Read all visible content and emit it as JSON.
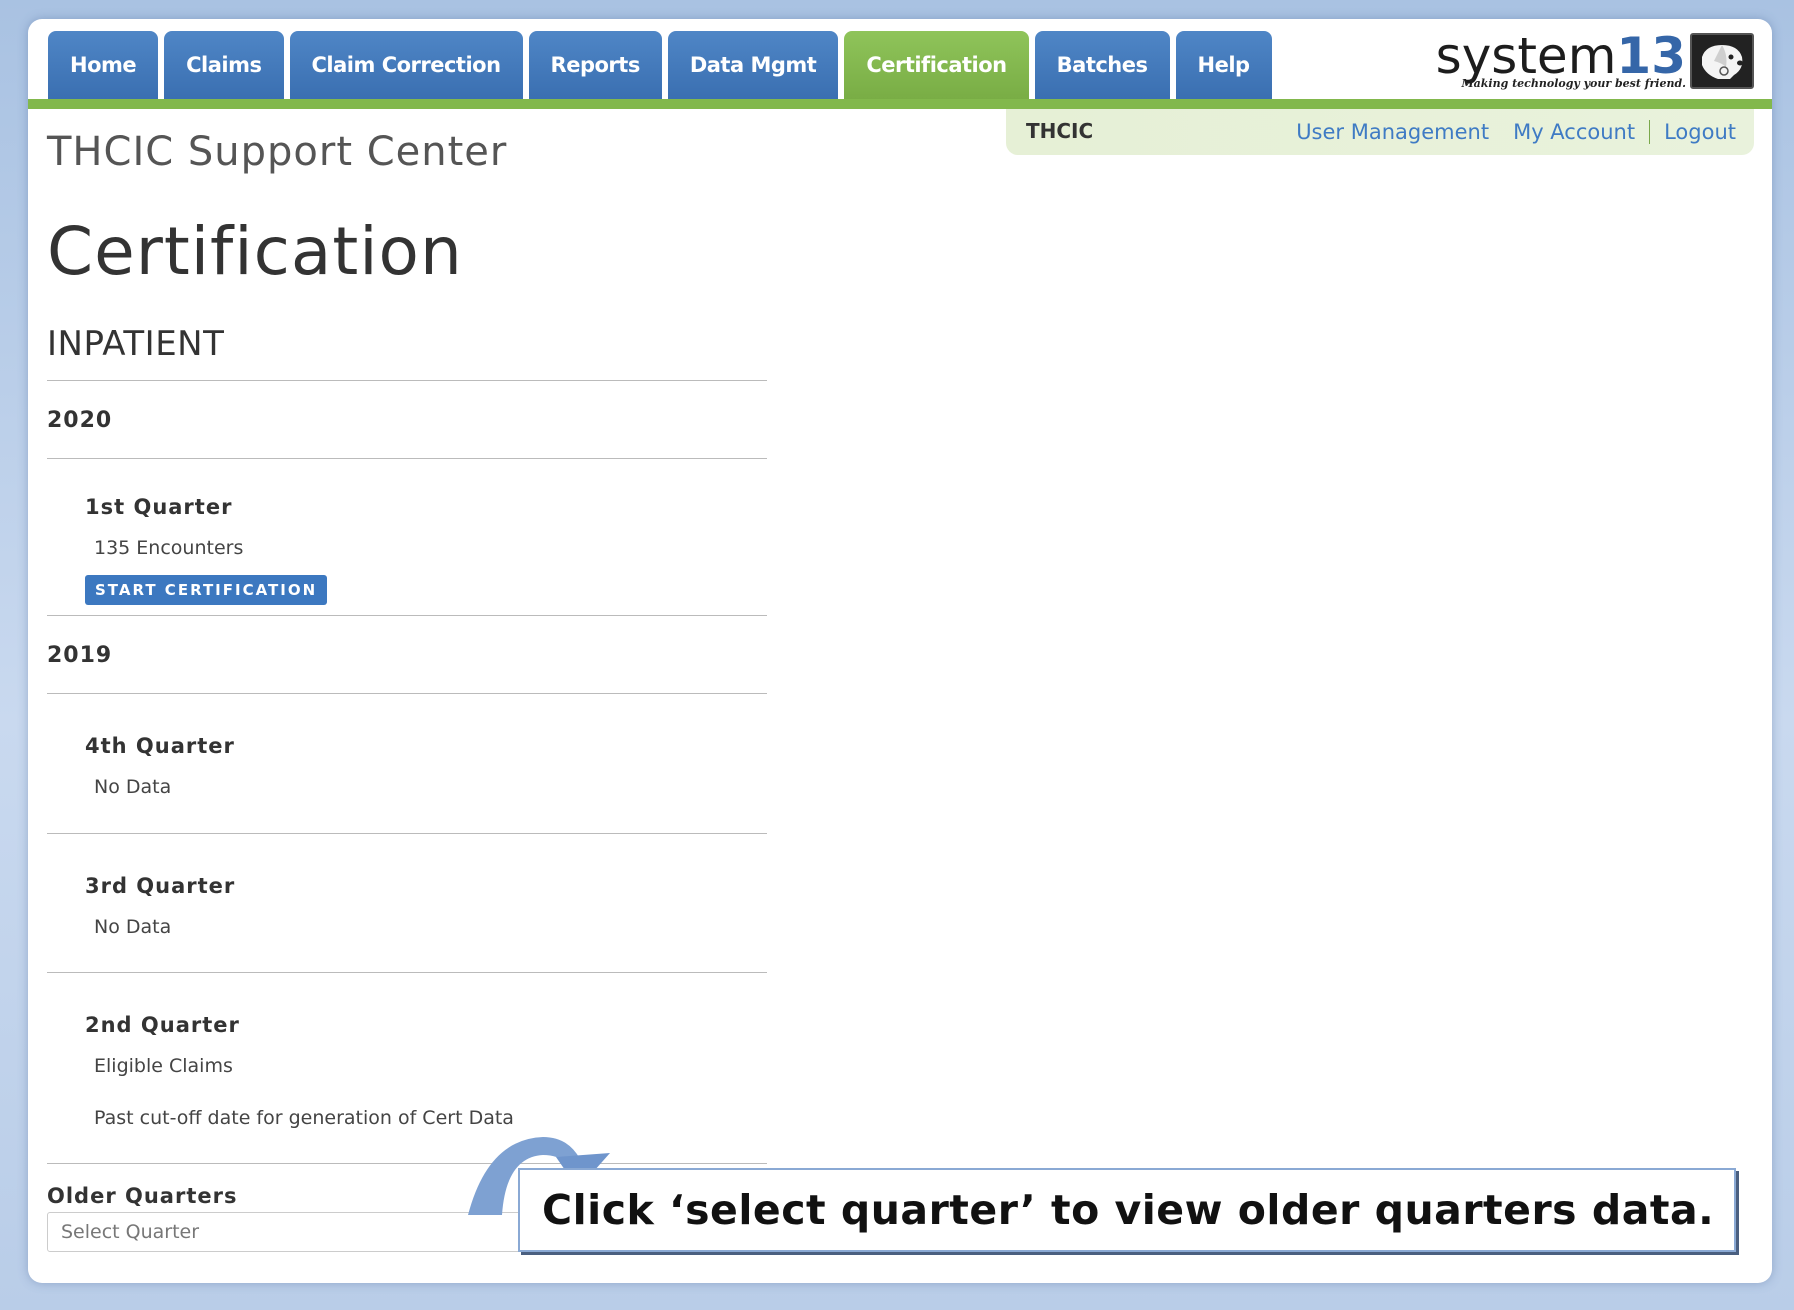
{
  "nav": {
    "tabs": [
      "Home",
      "Claims",
      "Claim Correction",
      "Reports",
      "Data Mgmt",
      "Certification",
      "Batches",
      "Help"
    ],
    "active": "Certification"
  },
  "logo": {
    "word": "system",
    "num": "13",
    "tagline": "Making technology your best friend."
  },
  "subbar": {
    "org": "THCIC",
    "user_management": "User Management",
    "my_account": "My Account",
    "logout": "Logout"
  },
  "site_title": "THCIC Support Center",
  "page_title": "Certification",
  "section_title": "INPATIENT",
  "years": [
    {
      "year": "2020",
      "quarters": [
        {
          "title": "1st Quarter",
          "text": "135 Encounters",
          "button": "START CERTIFICATION"
        }
      ]
    },
    {
      "year": "2019",
      "quarters": [
        {
          "title": "4th Quarter",
          "text": "No Data"
        },
        {
          "title": "3rd Quarter",
          "text": "No Data"
        },
        {
          "title": "2nd Quarter",
          "text": "Eligible Claims",
          "text2": "Past cut-off date for generation of Cert Data"
        }
      ]
    }
  ],
  "older": {
    "label": "Older Quarters",
    "placeholder": "Select Quarter"
  },
  "callout": "Click ‘select quarter’ to view older quarters data.",
  "colors": {
    "tab_blue": "#3f76b8",
    "tab_green": "#82b84c",
    "link_blue": "#3f7bc4"
  }
}
